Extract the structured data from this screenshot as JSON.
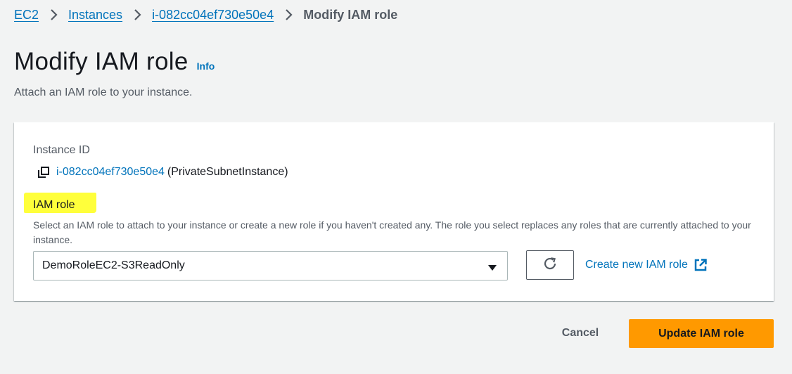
{
  "breadcrumb": {
    "items": [
      {
        "label": "EC2"
      },
      {
        "label": "Instances"
      },
      {
        "label": "i-082cc04ef730e50e4"
      },
      {
        "label": "Modify IAM role"
      }
    ]
  },
  "page": {
    "title": "Modify IAM role",
    "info_label": "Info",
    "description": "Attach an IAM role to your instance."
  },
  "panel": {
    "instance_id_label": "Instance ID",
    "instance_id": "i-082cc04ef730e50e4",
    "instance_name": "(PrivateSubnetInstance)",
    "iam_role_label": "IAM role",
    "iam_role_description": "Select an IAM role to attach to your instance or create a new role if you haven't created any. The role you select replaces any roles that are currently attached to your instance.",
    "iam_role_selected": "DemoRoleEC2-S3ReadOnly",
    "create_role_label": "Create new IAM role"
  },
  "icons": {
    "copy": "copy-icon",
    "refresh": "refresh-icon",
    "external": "external-link-icon",
    "caret": "caret-down-icon",
    "chevron": "chevron-right-icon"
  },
  "colors": {
    "link": "#0073bb",
    "primary_button": "#ff9900",
    "highlight": "#ffff3b"
  },
  "actions": {
    "cancel_label": "Cancel",
    "update_label": "Update IAM role"
  }
}
